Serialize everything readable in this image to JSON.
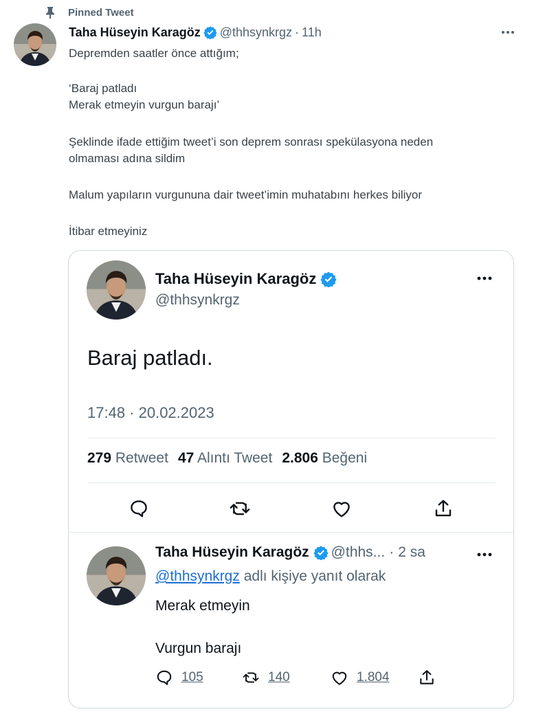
{
  "pinned": {
    "label": "Pinned Tweet"
  },
  "tweet": {
    "author_name": "Taha Hüseyin Karagöz",
    "handle": "@thhsynkrgz",
    "separator": "·",
    "time": "11h",
    "body": {
      "line1": "Depremden saatler önce attığım;",
      "line2": "‘Baraj patladı",
      "line3": "Merak etmeyin vurgun barajı’",
      "line4": "Şeklinde ifade ettiğim tweet’i son deprem sonrası spekülasyona neden",
      "line5": "olmaması adına sildim",
      "line6": "Malum yapıların vurgununa dair tweet’imin muhatabını herkes biliyor",
      "line7": "İtibar etmeyiniz"
    }
  },
  "quoted": {
    "author_name": "Taha Hüseyin Karagöz",
    "handle": "@thhsynkrgz",
    "text": "Baraj patladı.",
    "timestamp": "17:48 · 20.02.2023",
    "stats": {
      "retweets_num": "279",
      "retweets_label": "Retweet",
      "quotes_num": "47",
      "quotes_label": "Alıntı Tweet",
      "likes_num": "2.806",
      "likes_label": "Beğeni"
    }
  },
  "reply": {
    "author_name": "Taha Hüseyin Karagöz",
    "handle": "@thhs...",
    "separator": "·",
    "time": "2 sa",
    "replying_mention": "@thhsynkrgz",
    "replying_suffix": " adlı kişiye yanıt olarak",
    "line1": "Merak etmeyin",
    "line2": "Vurgun barajı",
    "counts": {
      "replies": "105",
      "retweets": "140",
      "likes": "1.804"
    }
  },
  "icons": {
    "pin": "pin-icon",
    "verified": "verified-badge-icon",
    "more": "more-horizontal-icon",
    "reply": "reply-bubble-icon",
    "retweet": "retweet-icon",
    "like": "heart-icon",
    "share": "share-icon"
  },
  "colors": {
    "verified": "#1d9bf0",
    "link": "#1d6fd2",
    "muted": "#536471"
  }
}
